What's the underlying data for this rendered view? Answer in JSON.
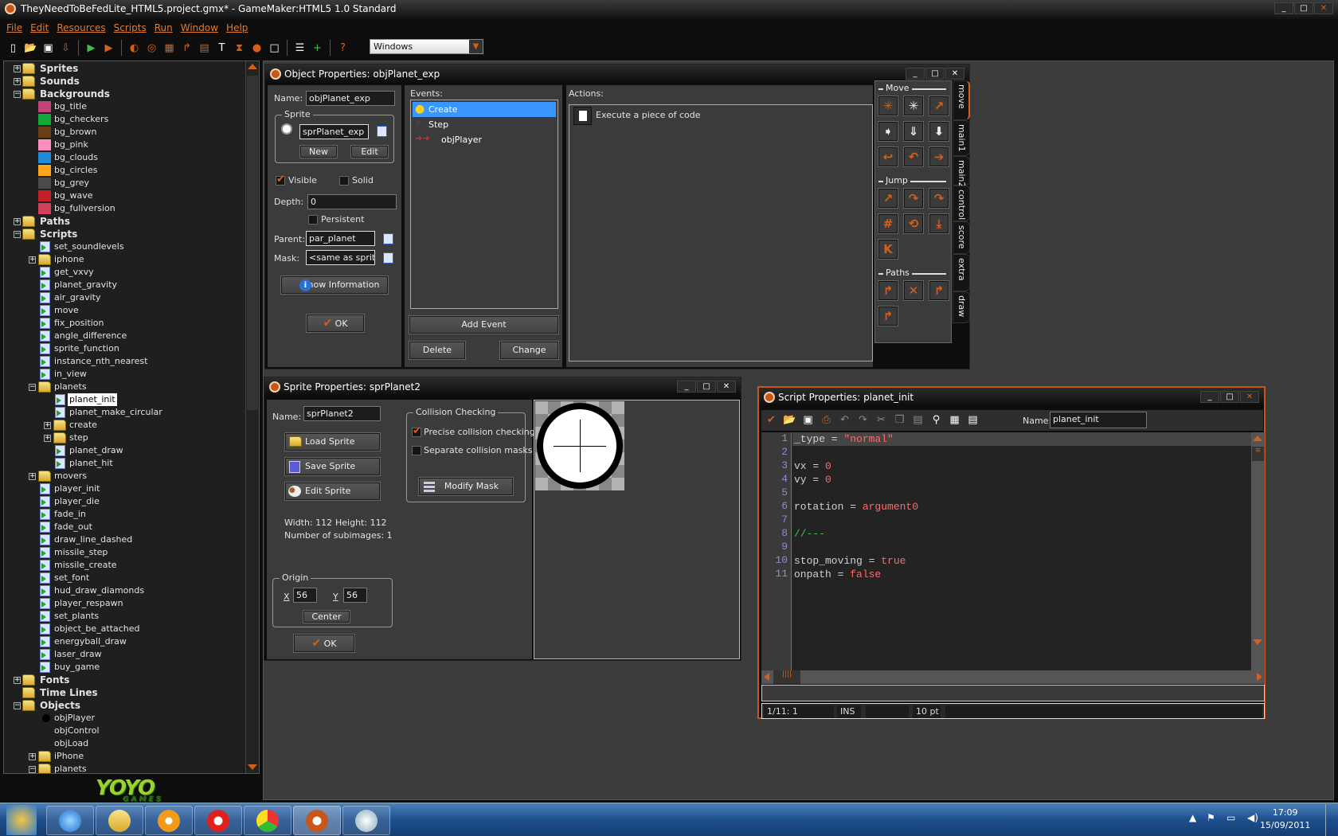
{
  "app": {
    "title": "TheyNeedToBeFedLite_HTML5.project.gmx* - GameMaker:HTML5 1.0 Standard",
    "menu": [
      "File",
      "Edit",
      "Resources",
      "Scripts",
      "Run",
      "Window",
      "Help"
    ],
    "toolbar_icons": [
      "new-icon",
      "open-icon",
      "save-icon",
      "export-icon",
      "|",
      "run-icon",
      "debug-run-icon",
      "|",
      "add-sprite-icon",
      "add-sound-icon",
      "add-background-icon",
      "add-path-icon",
      "add-script-icon",
      "add-font-icon",
      "add-timeline-icon",
      "add-object-icon",
      "add-room-icon",
      "|",
      "game-info-icon",
      "global-settings-icon",
      "|",
      "help-icon"
    ],
    "target_platform": "Windows",
    "accent_color": "#c8561a"
  },
  "tree": [
    {
      "label": "Sprites",
      "level": 0,
      "type": "folder",
      "exp": "+",
      "bold": true
    },
    {
      "label": "Sounds",
      "level": 0,
      "type": "folder",
      "exp": "+",
      "bold": true
    },
    {
      "label": "Backgrounds",
      "level": 0,
      "type": "folder",
      "exp": "-",
      "bold": true
    },
    {
      "label": "bg_title",
      "level": 1,
      "type": "bg",
      "color": "#c0437a"
    },
    {
      "label": "bg_checkers",
      "level": 1,
      "type": "bg",
      "color": "#12a838"
    },
    {
      "label": "bg_brown",
      "level": 1,
      "type": "bg",
      "color": "#6b3d14"
    },
    {
      "label": "bg_pink",
      "level": 1,
      "type": "bg",
      "color": "#ff8fc0"
    },
    {
      "label": "bg_clouds",
      "level": 1,
      "type": "bg",
      "color": "#1f8ad6"
    },
    {
      "label": "bg_circles",
      "level": 1,
      "type": "bg",
      "color": "#ffa51a"
    },
    {
      "label": "bg_grey",
      "level": 1,
      "type": "bg",
      "color": "#4a4a4a"
    },
    {
      "label": "bg_wave",
      "level": 1,
      "type": "bg",
      "color": "#c4202a"
    },
    {
      "label": "bg_fullversion",
      "level": 1,
      "type": "bg",
      "color": "#d0405a"
    },
    {
      "label": "Paths",
      "level": 0,
      "type": "folder",
      "exp": "+",
      "bold": true
    },
    {
      "label": "Scripts",
      "level": 0,
      "type": "folder",
      "exp": "-",
      "bold": true
    },
    {
      "label": "set_soundlevels",
      "level": 1,
      "type": "script"
    },
    {
      "label": "iphone",
      "level": 1,
      "type": "folder",
      "exp": "+"
    },
    {
      "label": "get_vxvy",
      "level": 1,
      "type": "script"
    },
    {
      "label": "planet_gravity",
      "level": 1,
      "type": "script"
    },
    {
      "label": "air_gravity",
      "level": 1,
      "type": "script"
    },
    {
      "label": "move",
      "level": 1,
      "type": "script"
    },
    {
      "label": "fix_position",
      "level": 1,
      "type": "script"
    },
    {
      "label": "angle_difference",
      "level": 1,
      "type": "script"
    },
    {
      "label": "sprite_function",
      "level": 1,
      "type": "script"
    },
    {
      "label": "instance_nth_nearest",
      "level": 1,
      "type": "script"
    },
    {
      "label": "in_view",
      "level": 1,
      "type": "script"
    },
    {
      "label": "planets",
      "level": 1,
      "type": "folder",
      "exp": "-"
    },
    {
      "label": "planet_init",
      "level": 2,
      "type": "script",
      "selected": true
    },
    {
      "label": "planet_make_circular",
      "level": 2,
      "type": "script"
    },
    {
      "label": "create",
      "level": 2,
      "type": "folder",
      "exp": "+"
    },
    {
      "label": "step",
      "level": 2,
      "type": "folder",
      "exp": "+"
    },
    {
      "label": "planet_draw",
      "level": 2,
      "type": "script"
    },
    {
      "label": "planet_hit",
      "level": 2,
      "type": "script"
    },
    {
      "label": "movers",
      "level": 1,
      "type": "folder",
      "exp": "+"
    },
    {
      "label": "player_init",
      "level": 1,
      "type": "script"
    },
    {
      "label": "player_die",
      "level": 1,
      "type": "script"
    },
    {
      "label": "fade_in",
      "level": 1,
      "type": "script"
    },
    {
      "label": "fade_out",
      "level": 1,
      "type": "script"
    },
    {
      "label": "draw_line_dashed",
      "level": 1,
      "type": "script"
    },
    {
      "label": "missile_step",
      "level": 1,
      "type": "script"
    },
    {
      "label": "missile_create",
      "level": 1,
      "type": "script"
    },
    {
      "label": "set_font",
      "level": 1,
      "type": "script"
    },
    {
      "label": "hud_draw_diamonds",
      "level": 1,
      "type": "script"
    },
    {
      "label": "player_respawn",
      "level": 1,
      "type": "script"
    },
    {
      "label": "set_plants",
      "level": 1,
      "type": "script"
    },
    {
      "label": "object_be_attached",
      "level": 1,
      "type": "script"
    },
    {
      "label": "energyball_draw",
      "level": 1,
      "type": "script"
    },
    {
      "label": "laser_draw",
      "level": 1,
      "type": "script"
    },
    {
      "label": "buy_game",
      "level": 1,
      "type": "script"
    },
    {
      "label": "Fonts",
      "level": 0,
      "type": "folder",
      "exp": "+",
      "bold": true
    },
    {
      "label": "Time Lines",
      "level": 0,
      "type": "folder",
      "bold": true
    },
    {
      "label": "Objects",
      "level": 0,
      "type": "folder",
      "exp": "-",
      "bold": true
    },
    {
      "label": "objPlayer",
      "level": 1,
      "type": "object"
    },
    {
      "label": "objControl",
      "level": 1,
      "type": "none"
    },
    {
      "label": "objLoad",
      "level": 1,
      "type": "none"
    },
    {
      "label": "iPhone",
      "level": 1,
      "type": "folder",
      "exp": "+"
    },
    {
      "label": "planets",
      "level": 1,
      "type": "folder",
      "exp": "-"
    }
  ],
  "logo": {
    "text": "YOYO",
    "sub": "GAMES"
  },
  "object_window": {
    "title": "Object Properties: objPlanet_exp",
    "name_label": "Name:",
    "name": "objPlanet_exp",
    "sprite_group": "Sprite",
    "sprite": "sprPlanet_exp",
    "new_label": "New",
    "edit_label": "Edit",
    "visible_label": "Visible",
    "visible": true,
    "solid_label": "Solid",
    "solid": false,
    "depth_label": "Depth:",
    "depth": "0",
    "persistent_label": "Persistent",
    "persistent": false,
    "parent_label": "Parent:",
    "parent": "par_planet",
    "mask_label": "Mask:",
    "mask": "<same as sprite>",
    "show_info_label": "Show Information",
    "ok_label": "OK",
    "events_label": "Events:",
    "events": [
      {
        "label": "Create",
        "icon": "lightbulb-icon",
        "selected": true
      },
      {
        "label": "Step",
        "icon": "footsteps-icon"
      },
      {
        "label": "objPlayer",
        "icon": "collision-icon"
      }
    ],
    "add_event_label": "Add Event",
    "delete_label": "Delete",
    "change_label": "Change",
    "actions_label": "Actions:",
    "actions": [
      {
        "label": "Execute a piece of code",
        "icon": "code-page-icon"
      }
    ],
    "library": {
      "sections": [
        {
          "title": "Move",
          "icons": [
            "move-fixed-icon",
            "move-free-icon",
            "move-towards-icon",
            "speed-horizontal-icon",
            "speed-vertical-icon",
            "gravity-icon",
            "reverse-horizontal-icon",
            "reverse-vertical-icon",
            "friction-icon"
          ]
        },
        {
          "title": "Jump",
          "icons": [
            "jump-to-position-icon",
            "jump-to-start-icon",
            "jump-to-random-icon",
            "align-grid-icon",
            "wrap-screen-icon",
            "move-to-contact-icon",
            "bounce-icon"
          ]
        },
        {
          "title": "Paths",
          "icons": [
            "set-path-icon",
            "end-path-icon",
            "path-position-icon",
            "path-speed-icon"
          ]
        }
      ],
      "tabs": [
        "move",
        "main1",
        "main2",
        "control",
        "score",
        "extra",
        "draw"
      ],
      "active_tab": "move"
    }
  },
  "sprite_window": {
    "title": "Sprite Properties: sprPlanet2",
    "name_label": "Name:",
    "name": "sprPlanet2",
    "load_label": "Load Sprite",
    "save_label": "Save Sprite",
    "edit_label": "Edit Sprite",
    "width_text": "Width: 112",
    "height_text": "Height: 112",
    "subimages_text": "Number of subimages: 1",
    "origin_group": "Origin",
    "x_label": "X",
    "origin_x": "56",
    "y_label": "Y",
    "origin_y": "56",
    "center_label": "Center",
    "ok_label": "OK",
    "collision_group": "Collision Checking",
    "precise_label": "Precise collision checking",
    "precise": true,
    "separate_label": "Separate collision masks",
    "separate": false,
    "modify_mask_label": "Modify Mask"
  },
  "script_window": {
    "title": "Script Properties: planet_init",
    "toolbar_icons": [
      "ok-check-icon",
      "load-icon",
      "save-icon",
      "print-icon",
      "undo-icon",
      "redo-icon",
      "cut-icon",
      "copy-icon",
      "paste-icon",
      "find-icon",
      "goto-line-icon",
      "syntax-check-icon"
    ],
    "name_label": "Name:",
    "name": "planet_init",
    "code": [
      [
        {
          "t": "_type = ",
          "c": "default"
        },
        {
          "t": "\"normal\"",
          "c": "string"
        }
      ],
      [],
      [
        {
          "t": "vx = ",
          "c": "default"
        },
        {
          "t": "0",
          "c": "number"
        }
      ],
      [
        {
          "t": "vy = ",
          "c": "default"
        },
        {
          "t": "0",
          "c": "number"
        }
      ],
      [],
      [
        {
          "t": "rotation = ",
          "c": "default"
        },
        {
          "t": "argument0",
          "c": "keyword"
        }
      ],
      [],
      [
        {
          "t": "//---",
          "c": "comment"
        }
      ],
      [],
      [
        {
          "t": "stop_moving = ",
          "c": "default"
        },
        {
          "t": "true",
          "c": "keyword"
        }
      ],
      [
        {
          "t": "onpath = ",
          "c": "default"
        },
        {
          "t": "false",
          "c": "keyword"
        }
      ]
    ],
    "status": {
      "position": "1/11:  1",
      "mode": "INS",
      "blank": "",
      "font_size": "10 pt"
    }
  },
  "taskbar": {
    "apps": [
      "windows-start-icon",
      "internet-explorer-icon",
      "file-explorer-icon",
      "media-player-icon",
      "red-app-icon",
      "chrome-icon",
      "gamemaker-icon",
      "paint-icon"
    ],
    "time": "17:09",
    "date": "15/09/2011"
  }
}
